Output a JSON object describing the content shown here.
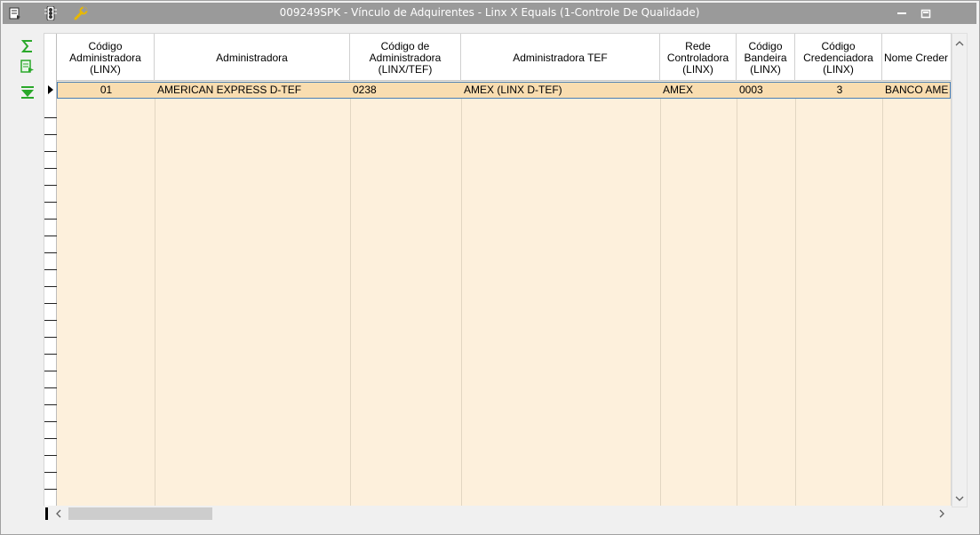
{
  "window": {
    "title": "009249SPK - Vínculo de Adquirentes - Linx X Equals (1-Controle De Qualidade)"
  },
  "titlebar_icons": [
    "form-icon",
    "traffic-light-icon",
    "wrench-icon"
  ],
  "window_buttons": [
    "minimize-icon",
    "restore-icon"
  ],
  "toolbar": {
    "buttons": [
      "sum-icon",
      "export-icon",
      "filter-down-icon"
    ]
  },
  "grid": {
    "columns": [
      "Código\nAdministradora\n(LINX)",
      "Administradora",
      "Código de\nAdministradora\n(LINX/TEF)",
      "Administradora TEF",
      "Rede\nControladora\n(LINX)",
      "Código\nBandeira\n(LINX)",
      "Código\nCredenciadora\n(LINX)",
      "Nome Creder"
    ],
    "rows": [
      [
        "01",
        "AMERICAN EXPRESS D-TEF",
        "0238",
        "AMEX (LINX D-TEF)",
        "AMEX",
        "0003",
        "3",
        "BANCO AME"
      ]
    ]
  },
  "colors": {
    "titlebar": "#9a9a9a",
    "grid_background": "#fdf0dc",
    "selected_row": "#f9ddb0",
    "selection_border": "#4a7fb5"
  }
}
